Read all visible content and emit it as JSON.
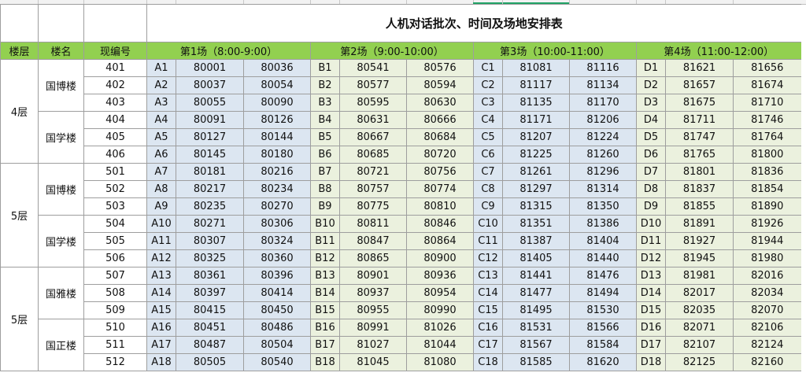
{
  "title": "人机对话批次、时间及场地安排表",
  "headers": {
    "floor": "楼层",
    "building": "楼名",
    "room": "现编号",
    "sessions": [
      "第1场（8:00-9:00）",
      "第2场（9:00-10:00）",
      "第3场（10:00-11:00）",
      "第4场（11:00-12:00）"
    ]
  },
  "floor_groups": [
    {
      "label": "4层",
      "rows": 6
    },
    {
      "label": "5层",
      "rows": 6
    },
    {
      "label": "5层",
      "rows": 6
    }
  ],
  "building_groups": [
    {
      "label": "国博楼",
      "rows": 3
    },
    {
      "label": "国学楼",
      "rows": 3
    },
    {
      "label": "国博楼",
      "rows": 3
    },
    {
      "label": "国学楼",
      "rows": 3
    },
    {
      "label": "国雅楼",
      "rows": 3
    },
    {
      "label": "国正楼",
      "rows": 3
    }
  ],
  "rows": [
    {
      "room": "401",
      "s": [
        [
          "A1",
          "80001",
          "80036"
        ],
        [
          "B1",
          "80541",
          "80576"
        ],
        [
          "C1",
          "81081",
          "81116"
        ],
        [
          "D1",
          "81621",
          "81656"
        ]
      ]
    },
    {
      "room": "402",
      "s": [
        [
          "A2",
          "80037",
          "80054"
        ],
        [
          "B2",
          "80577",
          "80594"
        ],
        [
          "C2",
          "81117",
          "81134"
        ],
        [
          "D2",
          "81657",
          "81674"
        ]
      ]
    },
    {
      "room": "403",
      "s": [
        [
          "A3",
          "80055",
          "80090"
        ],
        [
          "B3",
          "80595",
          "80630"
        ],
        [
          "C3",
          "81135",
          "81170"
        ],
        [
          "D3",
          "81675",
          "81710"
        ]
      ]
    },
    {
      "room": "404",
      "s": [
        [
          "A4",
          "80091",
          "80126"
        ],
        [
          "B4",
          "80631",
          "80666"
        ],
        [
          "C4",
          "81171",
          "81206"
        ],
        [
          "D4",
          "81711",
          "81746"
        ]
      ]
    },
    {
      "room": "405",
      "s": [
        [
          "A5",
          "80127",
          "80144"
        ],
        [
          "B5",
          "80667",
          "80684"
        ],
        [
          "C5",
          "81207",
          "81224"
        ],
        [
          "D5",
          "81747",
          "81764"
        ]
      ]
    },
    {
      "room": "406",
      "s": [
        [
          "A6",
          "80145",
          "80180"
        ],
        [
          "B6",
          "80685",
          "80720"
        ],
        [
          "C6",
          "81225",
          "81260"
        ],
        [
          "D6",
          "81765",
          "81800"
        ]
      ]
    },
    {
      "room": "501",
      "s": [
        [
          "A7",
          "80181",
          "80216"
        ],
        [
          "B7",
          "80721",
          "80756"
        ],
        [
          "C7",
          "81261",
          "81296"
        ],
        [
          "D7",
          "81801",
          "81836"
        ]
      ]
    },
    {
      "room": "502",
      "s": [
        [
          "A8",
          "80217",
          "80234"
        ],
        [
          "B8",
          "80757",
          "80774"
        ],
        [
          "C8",
          "81297",
          "81314"
        ],
        [
          "D8",
          "81837",
          "81854"
        ]
      ]
    },
    {
      "room": "503",
      "s": [
        [
          "A9",
          "80235",
          "80270"
        ],
        [
          "B9",
          "80775",
          "80810"
        ],
        [
          "C9",
          "81315",
          "81350"
        ],
        [
          "D9",
          "81855",
          "81890"
        ]
      ]
    },
    {
      "room": "504",
      "s": [
        [
          "A10",
          "80271",
          "80306"
        ],
        [
          "B10",
          "80811",
          "80846"
        ],
        [
          "C10",
          "81351",
          "81386"
        ],
        [
          "D10",
          "81891",
          "81926"
        ]
      ]
    },
    {
      "room": "505",
      "s": [
        [
          "A11",
          "80307",
          "80324"
        ],
        [
          "B11",
          "80847",
          "80864"
        ],
        [
          "C11",
          "81387",
          "81404"
        ],
        [
          "D11",
          "81927",
          "81944"
        ]
      ]
    },
    {
      "room": "506",
      "s": [
        [
          "A12",
          "80325",
          "80360"
        ],
        [
          "B12",
          "80865",
          "80900"
        ],
        [
          "C12",
          "81405",
          "81440"
        ],
        [
          "D12",
          "81945",
          "81980"
        ]
      ]
    },
    {
      "room": "507",
      "s": [
        [
          "A13",
          "80361",
          "80396"
        ],
        [
          "B13",
          "80901",
          "80936"
        ],
        [
          "C13",
          "81441",
          "81476"
        ],
        [
          "D13",
          "81981",
          "82016"
        ]
      ]
    },
    {
      "room": "508",
      "s": [
        [
          "A14",
          "80397",
          "80414"
        ],
        [
          "B14",
          "80937",
          "80954"
        ],
        [
          "C14",
          "81477",
          "81494"
        ],
        [
          "D14",
          "82017",
          "82034"
        ]
      ]
    },
    {
      "room": "509",
      "s": [
        [
          "A15",
          "80415",
          "80450"
        ],
        [
          "B15",
          "80955",
          "80990"
        ],
        [
          "C15",
          "81495",
          "81530"
        ],
        [
          "D15",
          "82035",
          "82070"
        ]
      ]
    },
    {
      "room": "510",
      "s": [
        [
          "A16",
          "80451",
          "80486"
        ],
        [
          "B16",
          "80991",
          "81026"
        ],
        [
          "C16",
          "81531",
          "81566"
        ],
        [
          "D16",
          "82071",
          "82106"
        ]
      ]
    },
    {
      "room": "511",
      "s": [
        [
          "A17",
          "80487",
          "80504"
        ],
        [
          "B17",
          "81027",
          "81044"
        ],
        [
          "C17",
          "81567",
          "81584"
        ],
        [
          "D17",
          "82107",
          "82124"
        ]
      ]
    },
    {
      "room": "512",
      "s": [
        [
          "A18",
          "80505",
          "80540"
        ],
        [
          "B18",
          "81045",
          "81080"
        ],
        [
          "C18",
          "81585",
          "81620"
        ],
        [
          "D18",
          "82125",
          "82160"
        ]
      ]
    }
  ],
  "colors": {
    "header_green": "#92d050",
    "blue_fill": "#dce6f1",
    "green_fill": "#ebf1de",
    "selection": "#21a366"
  }
}
